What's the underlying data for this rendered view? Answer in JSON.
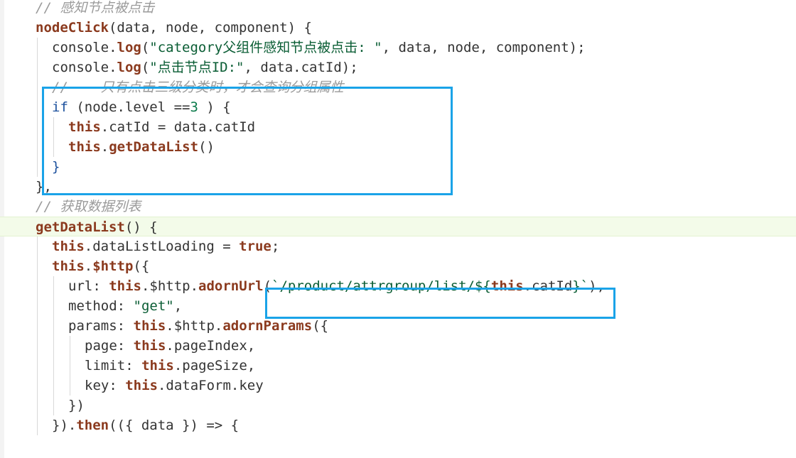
{
  "editor": {
    "colors": {
      "background": "#ffffff",
      "default": "#333333",
      "comment": "#9a9a9a",
      "function": "#8b3a1e",
      "keyword": "#1a4f9c",
      "string": "#0a5d34",
      "number": "#0a7a4a",
      "highlight": "#1aa3e8",
      "active_line": "#f3fbe9"
    },
    "lines": [
      {
        "indent": 2,
        "tokens": [
          {
            "t": "// 感知节点被点击",
            "k": "comment"
          }
        ]
      },
      {
        "indent": 2,
        "tokens": [
          {
            "t": "nodeClick",
            "k": "function"
          },
          {
            "t": "(data, node, component) {",
            "k": "default"
          }
        ]
      },
      {
        "indent": 3,
        "tokens": [
          {
            "t": "console.",
            "k": "default"
          },
          {
            "t": "log",
            "k": "function"
          },
          {
            "t": "(",
            "k": "default"
          },
          {
            "t": "\"category父组件感知节点被点击: \"",
            "k": "string"
          },
          {
            "t": ", data, node, component);",
            "k": "default"
          }
        ]
      },
      {
        "indent": 3,
        "tokens": [
          {
            "t": "console.",
            "k": "default"
          },
          {
            "t": "log",
            "k": "function"
          },
          {
            "t": "(",
            "k": "default"
          },
          {
            "t": "\"点击节点ID:\"",
            "k": "string"
          },
          {
            "t": ", data.catId);",
            "k": "default"
          }
        ]
      },
      {
        "indent": 3,
        "tokens": [
          {
            "t": "//    只有点击三级分类时，才会查询分组属性",
            "k": "comment"
          }
        ]
      },
      {
        "indent": 3,
        "tokens": [
          {
            "t": "if",
            "k": "keyword"
          },
          {
            "t": " (node.level ==",
            "k": "default"
          },
          {
            "t": "3",
            "k": "number"
          },
          {
            "t": " ) {",
            "k": "default"
          }
        ]
      },
      {
        "indent": 4,
        "tokens": [
          {
            "t": "this",
            "k": "function"
          },
          {
            "t": ".catId = data.catId",
            "k": "default"
          }
        ]
      },
      {
        "indent": 4,
        "tokens": [
          {
            "t": "this",
            "k": "function"
          },
          {
            "t": ".",
            "k": "default"
          },
          {
            "t": "getDataList",
            "k": "function"
          },
          {
            "t": "()",
            "k": "default"
          }
        ]
      },
      {
        "indent": 3,
        "tokens": [
          {
            "t": "}",
            "k": "keyword"
          }
        ]
      },
      {
        "indent": 2,
        "tokens": [
          {
            "t": "},",
            "k": "default"
          }
        ]
      },
      {
        "indent": 2,
        "tokens": [
          {
            "t": "// 获取数据列表",
            "k": "comment"
          }
        ]
      },
      {
        "indent": 2,
        "active": true,
        "tokens": [
          {
            "t": "getDataList",
            "k": "function"
          },
          {
            "t": "() {",
            "k": "default"
          }
        ]
      },
      {
        "indent": 3,
        "tokens": [
          {
            "t": "this",
            "k": "function"
          },
          {
            "t": ".dataListLoading = ",
            "k": "default"
          },
          {
            "t": "true",
            "k": "function"
          },
          {
            "t": ";",
            "k": "default"
          }
        ]
      },
      {
        "indent": 3,
        "tokens": [
          {
            "t": "this",
            "k": "function"
          },
          {
            "t": ".",
            "k": "default"
          },
          {
            "t": "$http",
            "k": "function"
          },
          {
            "t": "({",
            "k": "default"
          }
        ]
      },
      {
        "indent": 4,
        "tokens": [
          {
            "t": "url: ",
            "k": "default"
          },
          {
            "t": "this",
            "k": "function"
          },
          {
            "t": ".$http.",
            "k": "default"
          },
          {
            "t": "adornUrl",
            "k": "function"
          },
          {
            "t": "(",
            "k": "default"
          },
          {
            "t": "`/product/attrgroup/list/${",
            "k": "string"
          },
          {
            "t": "this",
            "k": "function"
          },
          {
            "t": ".catId",
            "k": "default"
          },
          {
            "t": "}`",
            "k": "string"
          },
          {
            "t": "),",
            "k": "default"
          }
        ]
      },
      {
        "indent": 4,
        "tokens": [
          {
            "t": "method: ",
            "k": "default"
          },
          {
            "t": "\"get\"",
            "k": "string"
          },
          {
            "t": ",",
            "k": "default"
          }
        ]
      },
      {
        "indent": 4,
        "tokens": [
          {
            "t": "params: ",
            "k": "default"
          },
          {
            "t": "this",
            "k": "function"
          },
          {
            "t": ".$http.",
            "k": "default"
          },
          {
            "t": "adornParams",
            "k": "function"
          },
          {
            "t": "({",
            "k": "default"
          }
        ]
      },
      {
        "indent": 5,
        "tokens": [
          {
            "t": "page: ",
            "k": "default"
          },
          {
            "t": "this",
            "k": "function"
          },
          {
            "t": ".pageIndex,",
            "k": "default"
          }
        ]
      },
      {
        "indent": 5,
        "tokens": [
          {
            "t": "limit: ",
            "k": "default"
          },
          {
            "t": "this",
            "k": "function"
          },
          {
            "t": ".pageSize,",
            "k": "default"
          }
        ]
      },
      {
        "indent": 5,
        "tokens": [
          {
            "t": "key: ",
            "k": "default"
          },
          {
            "t": "this",
            "k": "function"
          },
          {
            "t": ".dataForm.key",
            "k": "default"
          }
        ]
      },
      {
        "indent": 4,
        "tokens": [
          {
            "t": "})",
            "k": "default"
          }
        ]
      },
      {
        "indent": 3,
        "tokens": [
          {
            "t": "}).",
            "k": "default"
          },
          {
            "t": "then",
            "k": "function"
          },
          {
            "t": "(({ data }) => {",
            "k": "default"
          }
        ]
      }
    ]
  }
}
